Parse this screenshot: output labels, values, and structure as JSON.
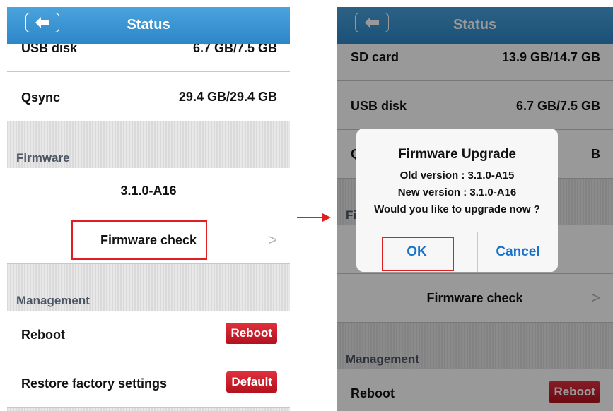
{
  "left_screen": {
    "title": "Status",
    "back_icon": "back-arrow-icon",
    "rows": {
      "usb_disk_label": "USB disk",
      "usb_disk_value": "6.7 GB/7.5 GB",
      "qsync_label": "Qsync",
      "qsync_value": "29.4 GB/29.4 GB"
    },
    "firmware": {
      "section_label": "Firmware",
      "version": "3.1.0-A16",
      "check_label": "Firmware check",
      "chevron": ">"
    },
    "management": {
      "section_label": "Management",
      "reboot_label": "Reboot",
      "reboot_button": "Reboot",
      "restore_label": "Restore factory settings",
      "default_button": "Default"
    }
  },
  "right_screen": {
    "title": "Status",
    "back_icon": "back-arrow-icon",
    "rows": {
      "sd_card_label": "SD card",
      "sd_card_value": "13.9 GB/14.7 GB",
      "usb_disk_label": "USB disk",
      "usb_disk_value": "6.7 GB/7.5 GB",
      "partial_label": "Q",
      "partial_value": "B"
    },
    "firmware": {
      "section_label_partial": "Fi",
      "check_label": "Firmware check",
      "chevron": ">"
    },
    "management": {
      "section_label": "Management",
      "reboot_label": "Reboot",
      "reboot_button": "Reboot"
    },
    "dialog": {
      "title": "Firmware Upgrade",
      "old_version": "Old version : 3.1.0-A15",
      "new_version": "New version : 3.1.0-A16",
      "prompt": "Would you like to upgrade now ?",
      "ok_button": "OK",
      "cancel_button": "Cancel"
    }
  },
  "colors": {
    "nav_blue": "#2d87c8",
    "highlight_red": "#e02020",
    "button_red": "#c41e2a",
    "dialog_button_blue": "#1a73c9"
  }
}
